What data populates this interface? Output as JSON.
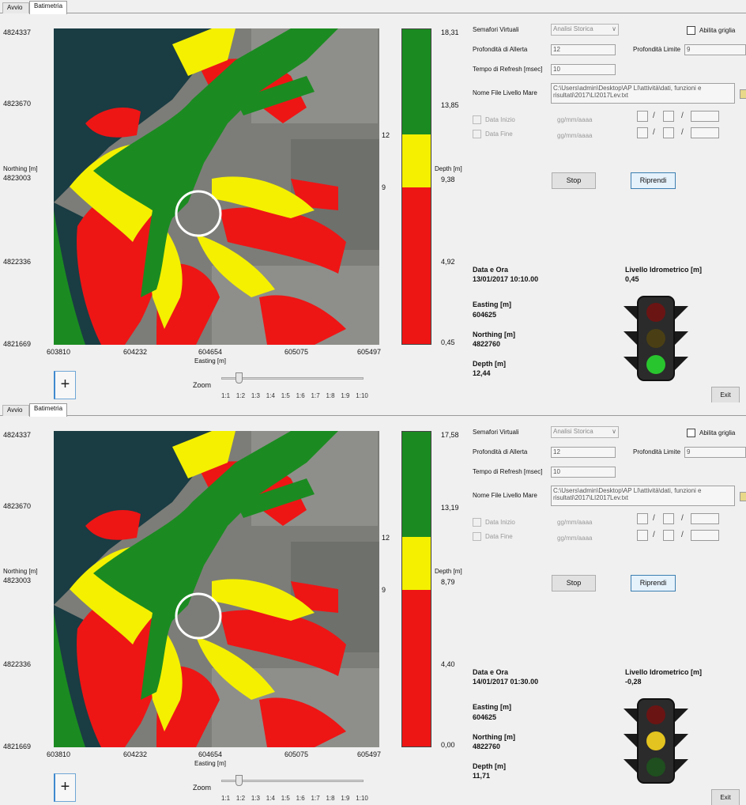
{
  "tabs": [
    "Avvio",
    "Batimetria"
  ],
  "colors": {
    "green": "#1b8b21",
    "yellow": "#f4f000",
    "red": "#ee1515",
    "sea": "#1a3c43",
    "land": "#7c7d78",
    "light_off": "#3a3a3a",
    "light_red": "#6b1414",
    "light_yellow_on": "#e3c31f",
    "light_green_on": "#29c52e",
    "light_green_dim": "#1f4e1f"
  },
  "axis": {
    "y_label_1": "Northing [m]",
    "x_label": "Easting [m]",
    "y_ticks": [
      "4824337",
      "4823670",
      "4823003",
      "4822336",
      "4821669"
    ],
    "x_ticks": [
      "603810",
      "604232",
      "604654",
      "605075",
      "605497"
    ],
    "colorbar_label": "Depth [m]",
    "threshold_marks": [
      "12",
      "9"
    ]
  },
  "controls": {
    "semafori_label": "Semafori Virtuali",
    "semafori_value": "Analisi Storica",
    "abilita_label": "Abilita griglia",
    "allerta_label": "Profondità di Allerta",
    "allerta_value": "12",
    "limite_label": "Profondità Limite",
    "limite_value": "9",
    "refresh_label": "Tempo di Refresh [msec]",
    "refresh_value": "10",
    "file_label": "Nome File Livello Mare",
    "file_value": "C:\\Users\\admin\\Desktop\\AP LI\\attività\\dati, funzioni e risultati\\2017\\LI2017Lev.txt",
    "data_inizio_label": "Data Inizio",
    "data_fine_label": "Data Fine",
    "date_placeholder": "gg/mm/aaaa",
    "date_slash": "/",
    "stop_label": "Stop",
    "riprendi_label": "Riprendi",
    "exit_label": "Exit",
    "zoom_label": "Zoom",
    "zoom_ticks": [
      "1:1",
      "1:2",
      "1:3",
      "1:4",
      "1:5",
      "1:6",
      "1:7",
      "1:8",
      "1:9",
      "1:10"
    ],
    "zoom_level_index": 1,
    "plus_label": "+"
  },
  "info_labels": {
    "data_ora": "Data e Ora",
    "livello": "Livello Idrometrico [m]",
    "easting": "Easting [m]",
    "northing": "Northing [m]",
    "depth": "Depth [m]"
  },
  "panels": [
    {
      "colorbar_ticks": [
        "18,31",
        "13,85",
        "9,38",
        "4,92",
        "0,45"
      ],
      "data_ora": "13/01/2017 10:10.00",
      "livello": "0,45",
      "easting": "604625",
      "northing": "4822760",
      "depth": "12,44",
      "active_light": "green"
    },
    {
      "colorbar_ticks": [
        "17,58",
        "13,19",
        "8,79",
        "4,40",
        "0,00"
      ],
      "data_ora": "14/01/2017 01:30.00",
      "livello": "-0,28",
      "easting": "604625",
      "northing": "4822760",
      "depth": "11,71",
      "active_light": "yellow"
    }
  ]
}
